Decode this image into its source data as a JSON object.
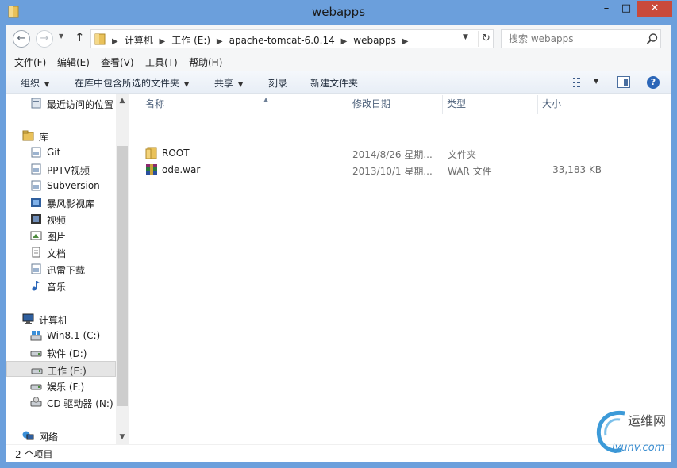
{
  "window": {
    "title": "webapps",
    "buttons": {
      "minimize": "–",
      "maximize": "□",
      "close": "✕"
    },
    "accent_color": "#6b9fdc",
    "close_color": "#c94a3b"
  },
  "address": {
    "back_icon": "back-arrow-icon",
    "forward_icon": "forward-arrow-icon",
    "crumbs": [
      "计算机",
      "工作 (E:)",
      "apache-tomcat-6.0.14",
      "webapps"
    ],
    "search_placeholder": "搜索 webapps"
  },
  "menu": [
    "文件(F)",
    "编辑(E)",
    "查看(V)",
    "工具(T)",
    "帮助(H)"
  ],
  "commands": {
    "organize": "组织",
    "include_in_library": "在库中包含所选的文件夹",
    "share": "共享",
    "burn": "刻录",
    "new_folder": "新建文件夹"
  },
  "nav": {
    "recent": "最近访问的位置",
    "library": "库",
    "library_items": [
      "Git",
      "PPTV视频",
      "Subversion",
      "暴风影视库",
      "视频",
      "图片",
      "文档",
      "迅雷下载",
      "音乐"
    ],
    "computer": "计算机",
    "drives": [
      "Win8.1 (C:)",
      "软件 (D:)",
      "工作 (E:)",
      "娱乐 (F:)",
      "CD 驱动器 (N:)"
    ],
    "network": "网络",
    "selected": "工作 (E:)"
  },
  "columns": {
    "name": "名称",
    "date": "修改日期",
    "type": "类型",
    "size": "大小"
  },
  "files": [
    {
      "name": "ROOT",
      "date": "2014/8/26 星期...",
      "type": "文件夹",
      "size": "",
      "icon": "folder-icon"
    },
    {
      "name": "ode.war",
      "date": "2013/10/1 星期...",
      "type": "WAR 文件",
      "size": "33,183 KB",
      "icon": "archive-icon"
    }
  ],
  "status": {
    "count": "2 个项目"
  },
  "watermark": {
    "cn": "运维网",
    "en": "iyunv.com"
  }
}
